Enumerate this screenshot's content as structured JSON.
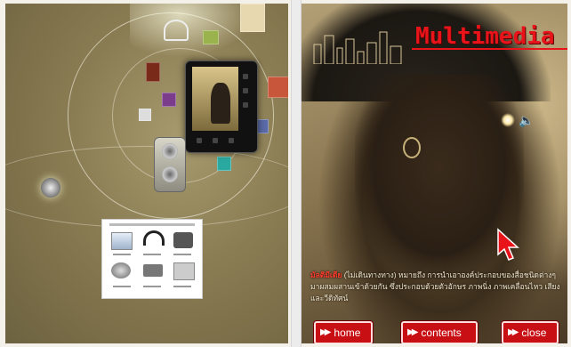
{
  "right_page": {
    "title": "Multimedia",
    "description_keyword": "มัลติมีเดีย",
    "description_text": "(ไม่เดินทางทาง) หมายถึง การนำเอาองค์ประกอบของสื่อชนิดต่างๆ มาผสมผสานเข้าด้วยกัน ซึ่งประกอบด้วยตัวอักษร ภาพนิ่ง ภาพเคลื่อนไหว เสียง และวีดิทัศน์",
    "speaker_symbol": "🔈",
    "buttons": {
      "home": "home",
      "contents": "contents",
      "close": "close"
    }
  },
  "icons": [
    "music-player-icon",
    "speaker-icon",
    "camera-icon",
    "headphones-icon",
    "film-reel-icon",
    "cursor-arrow-icon"
  ],
  "colors": {
    "title_red": "#e8141a",
    "button_red": "#c80f14",
    "left_bg": "#8a7c52",
    "right_bg": "#8a7650"
  }
}
